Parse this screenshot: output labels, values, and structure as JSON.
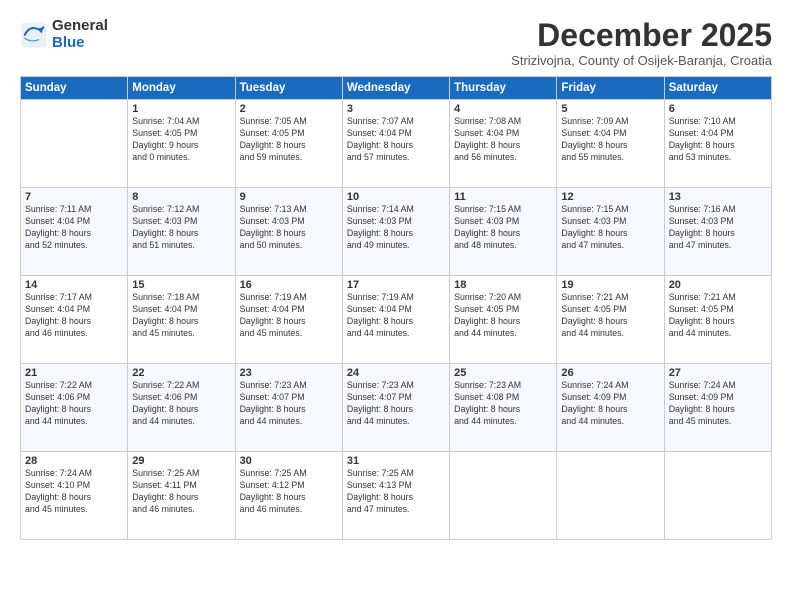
{
  "logo": {
    "general": "General",
    "blue": "Blue"
  },
  "header": {
    "month": "December 2025",
    "subtitle": "Strizivojna, County of Osijek-Baranja, Croatia"
  },
  "weekdays": [
    "Sunday",
    "Monday",
    "Tuesday",
    "Wednesday",
    "Thursday",
    "Friday",
    "Saturday"
  ],
  "weeks": [
    [
      {
        "day": "",
        "info": ""
      },
      {
        "day": "1",
        "info": "Sunrise: 7:04 AM\nSunset: 4:05 PM\nDaylight: 9 hours\nand 0 minutes."
      },
      {
        "day": "2",
        "info": "Sunrise: 7:05 AM\nSunset: 4:05 PM\nDaylight: 8 hours\nand 59 minutes."
      },
      {
        "day": "3",
        "info": "Sunrise: 7:07 AM\nSunset: 4:04 PM\nDaylight: 8 hours\nand 57 minutes."
      },
      {
        "day": "4",
        "info": "Sunrise: 7:08 AM\nSunset: 4:04 PM\nDaylight: 8 hours\nand 56 minutes."
      },
      {
        "day": "5",
        "info": "Sunrise: 7:09 AM\nSunset: 4:04 PM\nDaylight: 8 hours\nand 55 minutes."
      },
      {
        "day": "6",
        "info": "Sunrise: 7:10 AM\nSunset: 4:04 PM\nDaylight: 8 hours\nand 53 minutes."
      }
    ],
    [
      {
        "day": "7",
        "info": "Sunrise: 7:11 AM\nSunset: 4:04 PM\nDaylight: 8 hours\nand 52 minutes."
      },
      {
        "day": "8",
        "info": "Sunrise: 7:12 AM\nSunset: 4:03 PM\nDaylight: 8 hours\nand 51 minutes."
      },
      {
        "day": "9",
        "info": "Sunrise: 7:13 AM\nSunset: 4:03 PM\nDaylight: 8 hours\nand 50 minutes."
      },
      {
        "day": "10",
        "info": "Sunrise: 7:14 AM\nSunset: 4:03 PM\nDaylight: 8 hours\nand 49 minutes."
      },
      {
        "day": "11",
        "info": "Sunrise: 7:15 AM\nSunset: 4:03 PM\nDaylight: 8 hours\nand 48 minutes."
      },
      {
        "day": "12",
        "info": "Sunrise: 7:15 AM\nSunset: 4:03 PM\nDaylight: 8 hours\nand 47 minutes."
      },
      {
        "day": "13",
        "info": "Sunrise: 7:16 AM\nSunset: 4:03 PM\nDaylight: 8 hours\nand 47 minutes."
      }
    ],
    [
      {
        "day": "14",
        "info": "Sunrise: 7:17 AM\nSunset: 4:04 PM\nDaylight: 8 hours\nand 46 minutes."
      },
      {
        "day": "15",
        "info": "Sunrise: 7:18 AM\nSunset: 4:04 PM\nDaylight: 8 hours\nand 45 minutes."
      },
      {
        "day": "16",
        "info": "Sunrise: 7:19 AM\nSunset: 4:04 PM\nDaylight: 8 hours\nand 45 minutes."
      },
      {
        "day": "17",
        "info": "Sunrise: 7:19 AM\nSunset: 4:04 PM\nDaylight: 8 hours\nand 44 minutes."
      },
      {
        "day": "18",
        "info": "Sunrise: 7:20 AM\nSunset: 4:05 PM\nDaylight: 8 hours\nand 44 minutes."
      },
      {
        "day": "19",
        "info": "Sunrise: 7:21 AM\nSunset: 4:05 PM\nDaylight: 8 hours\nand 44 minutes."
      },
      {
        "day": "20",
        "info": "Sunrise: 7:21 AM\nSunset: 4:05 PM\nDaylight: 8 hours\nand 44 minutes."
      }
    ],
    [
      {
        "day": "21",
        "info": "Sunrise: 7:22 AM\nSunset: 4:06 PM\nDaylight: 8 hours\nand 44 minutes."
      },
      {
        "day": "22",
        "info": "Sunrise: 7:22 AM\nSunset: 4:06 PM\nDaylight: 8 hours\nand 44 minutes."
      },
      {
        "day": "23",
        "info": "Sunrise: 7:23 AM\nSunset: 4:07 PM\nDaylight: 8 hours\nand 44 minutes."
      },
      {
        "day": "24",
        "info": "Sunrise: 7:23 AM\nSunset: 4:07 PM\nDaylight: 8 hours\nand 44 minutes."
      },
      {
        "day": "25",
        "info": "Sunrise: 7:23 AM\nSunset: 4:08 PM\nDaylight: 8 hours\nand 44 minutes."
      },
      {
        "day": "26",
        "info": "Sunrise: 7:24 AM\nSunset: 4:09 PM\nDaylight: 8 hours\nand 44 minutes."
      },
      {
        "day": "27",
        "info": "Sunrise: 7:24 AM\nSunset: 4:09 PM\nDaylight: 8 hours\nand 45 minutes."
      }
    ],
    [
      {
        "day": "28",
        "info": "Sunrise: 7:24 AM\nSunset: 4:10 PM\nDaylight: 8 hours\nand 45 minutes."
      },
      {
        "day": "29",
        "info": "Sunrise: 7:25 AM\nSunset: 4:11 PM\nDaylight: 8 hours\nand 46 minutes."
      },
      {
        "day": "30",
        "info": "Sunrise: 7:25 AM\nSunset: 4:12 PM\nDaylight: 8 hours\nand 46 minutes."
      },
      {
        "day": "31",
        "info": "Sunrise: 7:25 AM\nSunset: 4:13 PM\nDaylight: 8 hours\nand 47 minutes."
      },
      {
        "day": "",
        "info": ""
      },
      {
        "day": "",
        "info": ""
      },
      {
        "day": "",
        "info": ""
      }
    ]
  ]
}
